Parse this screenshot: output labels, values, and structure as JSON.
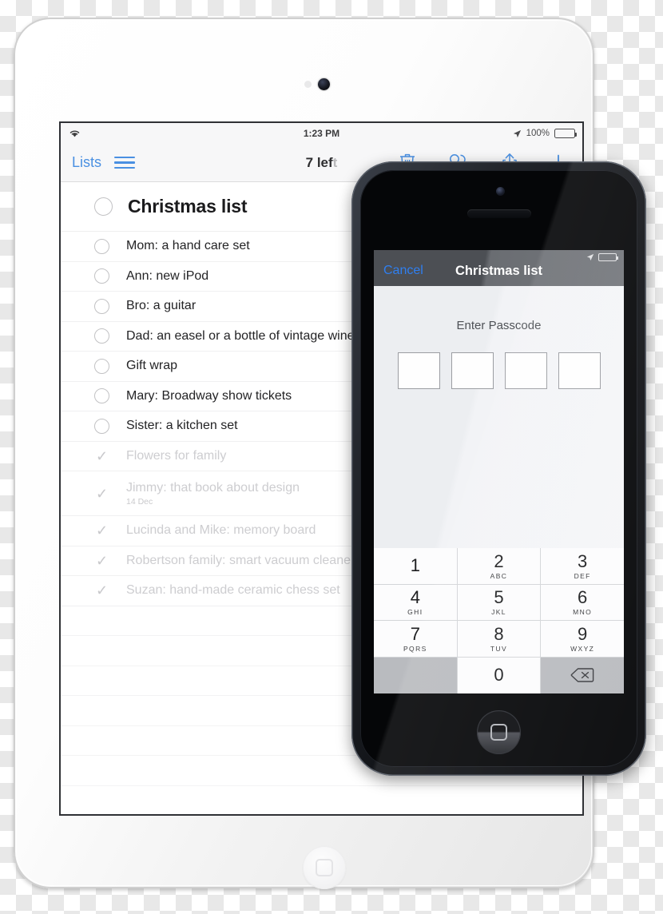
{
  "ipad": {
    "status_bar": {
      "wifi_icon": "wifi-icon",
      "time": "1:23 PM",
      "location_icon": "location-arrow-icon",
      "battery_percent": "100%",
      "battery_icon": "battery-full-icon"
    },
    "toolbar": {
      "back_label": "Lists",
      "menu_icon": "hamburger-menu-icon",
      "remaining_label": "7 left",
      "remaining_count": "7 lef",
      "remaining_suffix": "t",
      "actions": [
        {
          "name": "delete-button",
          "icon": "trash-icon"
        },
        {
          "name": "share-people-button",
          "icon": "people-icon"
        },
        {
          "name": "share-button",
          "icon": "share-upload-icon"
        },
        {
          "name": "add-button",
          "icon": "plus-icon"
        }
      ],
      "accent_color": "#4a90e2"
    },
    "list": {
      "title": "Christmas list",
      "tasks": [
        {
          "label": "Mom: a hand care set",
          "done": false
        },
        {
          "label": "Ann: new iPod",
          "done": false
        },
        {
          "label": "Bro: a guitar",
          "done": false
        },
        {
          "label": "Dad: an easel or a bottle of vintage wine",
          "done": false
        },
        {
          "label": "Gift wrap",
          "done": false
        },
        {
          "label": "Mary: Broadway show tickets",
          "done": false
        },
        {
          "label": "Sister: a kitchen set",
          "done": false
        },
        {
          "label": "Flowers for family",
          "done": true
        },
        {
          "label": "Jimmy: that book about design",
          "done": true,
          "subtitle": "14 Dec"
        },
        {
          "label": "Lucinda and Mike: memory board",
          "done": true
        },
        {
          "label": "Robertson family: smart vacuum cleaner",
          "done": true
        },
        {
          "label": "Suzan: hand-made ceramic chess set",
          "done": true
        }
      ],
      "empty_row_count": 7
    },
    "hardware": {
      "camera": "front-camera",
      "sensor": "ambient-light-sensor",
      "home_button": "home-button"
    }
  },
  "iphone": {
    "nav": {
      "cancel_label": "Cancel",
      "title": "Christmas list",
      "cancel_color": "#2f7ff0",
      "location_icon": "location-arrow-icon",
      "battery_icon": "battery-full-icon"
    },
    "passcode": {
      "prompt": "Enter Passcode",
      "box_count": 4,
      "entered_digits": 0
    },
    "keypad": {
      "keys": [
        {
          "num": "1",
          "letters": ""
        },
        {
          "num": "2",
          "letters": "ABC"
        },
        {
          "num": "3",
          "letters": "DEF"
        },
        {
          "num": "4",
          "letters": "GHI"
        },
        {
          "num": "5",
          "letters": "JKL"
        },
        {
          "num": "6",
          "letters": "MNO"
        },
        {
          "num": "7",
          "letters": "PQRS"
        },
        {
          "num": "8",
          "letters": "TUV"
        },
        {
          "num": "9",
          "letters": "WXYZ"
        },
        {
          "num": "0",
          "letters": ""
        }
      ],
      "delete_icon": "backspace-delete-icon"
    },
    "hardware": {
      "camera": "front-camera",
      "speaker": "earpiece-speaker",
      "home_button": "home-button"
    }
  }
}
